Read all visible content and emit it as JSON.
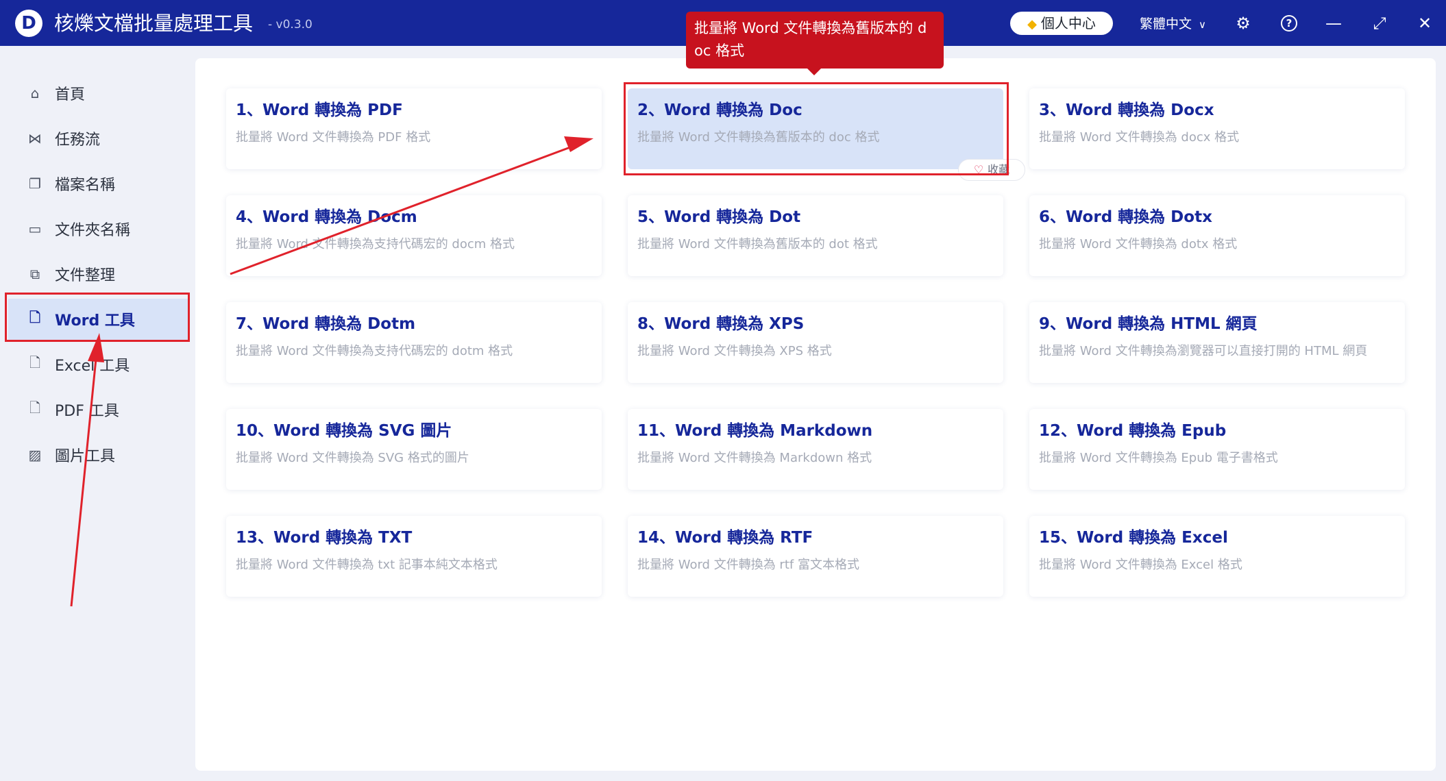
{
  "window": {
    "title": "核爍文檔批量處理工具",
    "version": "- v0.3.0",
    "logo_letter": "D"
  },
  "titlebar": {
    "vip_label": "個人中心",
    "language": "繁體中文",
    "icons": [
      "settings-icon",
      "help-icon",
      "minimize-icon",
      "maximize-icon",
      "close-icon"
    ]
  },
  "sidebar": {
    "items": [
      {
        "label": "首頁",
        "icon": "home-icon"
      },
      {
        "label": "任務流",
        "icon": "workflow-icon"
      },
      {
        "label": "檔案名稱",
        "icon": "file-name-icon"
      },
      {
        "label": "文件夾名稱",
        "icon": "folder-icon"
      },
      {
        "label": "文件整理",
        "icon": "organize-icon"
      },
      {
        "label": "Word 工具",
        "icon": "word-icon",
        "active": true
      },
      {
        "label": "Excel 工具",
        "icon": "excel-icon"
      },
      {
        "label": "PDF 工具",
        "icon": "pdf-icon"
      },
      {
        "label": "圖片工具",
        "icon": "image-icon"
      }
    ]
  },
  "cards": [
    {
      "title": "1、Word 轉換為 PDF",
      "desc": "批量將 Word 文件轉換為 PDF 格式"
    },
    {
      "title": "2、Word 轉換為 Doc",
      "desc": "批量將 Word 文件轉換為舊版本的 doc 格式",
      "selected": true
    },
    {
      "title": "3、Word 轉換為 Docx",
      "desc": "批量將 Word 文件轉換為 docx 格式"
    },
    {
      "title": "4、Word 轉換為 Docm",
      "desc": "批量將 Word 文件轉換為支持代碼宏的 docm 格式"
    },
    {
      "title": "5、Word 轉換為 Dot",
      "desc": "批量將 Word 文件轉換為舊版本的 dot 格式"
    },
    {
      "title": "6、Word 轉換為 Dotx",
      "desc": "批量將 Word 文件轉換為 dotx 格式"
    },
    {
      "title": "7、Word 轉換為 Dotm",
      "desc": "批量將 Word 文件轉換為支持代碼宏的 dotm 格式"
    },
    {
      "title": "8、Word 轉換為 XPS",
      "desc": "批量將 Word 文件轉換為 XPS 格式"
    },
    {
      "title": "9、Word 轉換為 HTML 網頁",
      "desc": "批量將 Word 文件轉換為瀏覽器可以直接打開的 HTML 網頁"
    },
    {
      "title": "10、Word 轉換為 SVG 圖片",
      "desc": "批量將 Word 文件轉換為 SVG 格式的圖片"
    },
    {
      "title": "11、Word 轉換為 Markdown",
      "desc": "批量將 Word 文件轉換為 Markdown 格式"
    },
    {
      "title": "12、Word 轉換為 Epub",
      "desc": "批量將 Word 文件轉換為 Epub 電子書格式"
    },
    {
      "title": "13、Word 轉換為 TXT",
      "desc": "批量將 Word 文件轉換為 txt 記事本純文本格式"
    },
    {
      "title": "14、Word 轉換為 RTF",
      "desc": "批量將 Word 文件轉換為 rtf 富文本格式"
    },
    {
      "title": "15、Word 轉換為 Excel",
      "desc": "批量將 Word 文件轉換為 Excel 格式"
    }
  ],
  "favorite_label": "收藏",
  "tooltip": "批量將 Word 文件轉換為舊版本的 doc 格式",
  "colors": {
    "brand": "#16279a",
    "accent_red": "#e0222b",
    "selected_bg": "#d8e3f8"
  }
}
